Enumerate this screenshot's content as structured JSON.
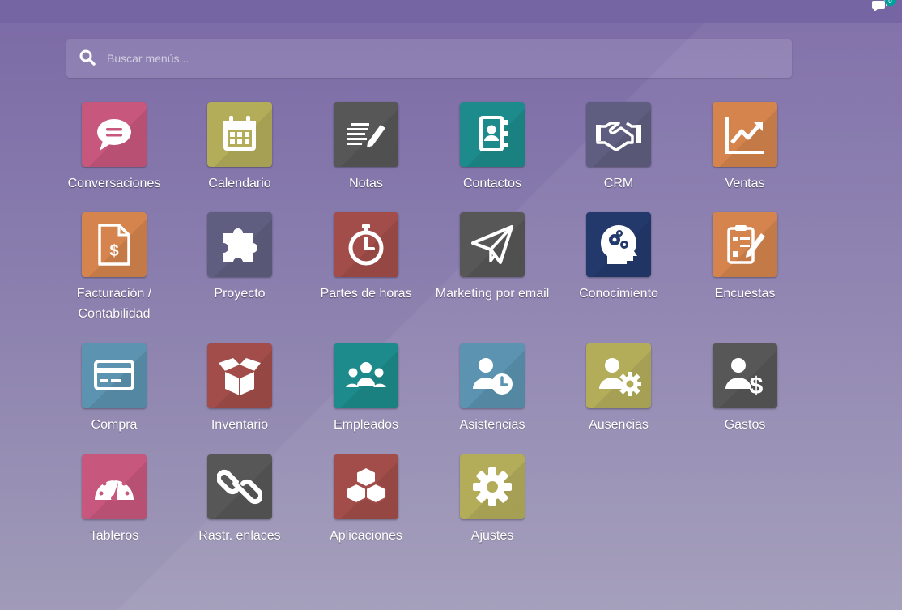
{
  "topbar": {
    "chat_badge": "0"
  },
  "search": {
    "placeholder": "Buscar menús..."
  },
  "apps": [
    {
      "label": "Conversaciones",
      "icon": "chat-bubble-icon",
      "color": "#c8577e"
    },
    {
      "label": "Calendario",
      "icon": "calendar-icon",
      "color": "#b3ad5a"
    },
    {
      "label": "Notas",
      "icon": "notes-pen-icon",
      "color": "#575757"
    },
    {
      "label": "Contactos",
      "icon": "address-book-icon",
      "color": "#1d8b8b"
    },
    {
      "label": "CRM",
      "icon": "handshake-icon",
      "color": "#5f5e80"
    },
    {
      "label": "Ventas",
      "icon": "line-chart-icon",
      "color": "#d5844d"
    },
    {
      "label": "Facturación /\nContabilidad",
      "icon": "invoice-dollar-icon",
      "color": "#d5844d"
    },
    {
      "label": "Proyecto",
      "icon": "puzzle-icon",
      "color": "#5f5e80"
    },
    {
      "label": "Partes de horas",
      "icon": "stopwatch-icon",
      "color": "#a24d4a"
    },
    {
      "label": "Marketing por email",
      "icon": "paper-plane-icon",
      "color": "#575757"
    },
    {
      "label": "Conocimiento",
      "icon": "head-gears-icon",
      "color": "#23396b"
    },
    {
      "label": "Encuestas",
      "icon": "clipboard-check-icon",
      "color": "#d5844d"
    },
    {
      "label": "Compra",
      "icon": "credit-card-icon",
      "color": "#5b93b0"
    },
    {
      "label": "Inventario",
      "icon": "open-box-icon",
      "color": "#a24d4a"
    },
    {
      "label": "Empleados",
      "icon": "people-group-icon",
      "color": "#1d8b8b"
    },
    {
      "label": "Asistencias",
      "icon": "user-clock-icon",
      "color": "#5b93b0"
    },
    {
      "label": "Ausencias",
      "icon": "user-gear-icon",
      "color": "#b3ad5a"
    },
    {
      "label": "Gastos",
      "icon": "user-dollar-icon",
      "color": "#575757"
    },
    {
      "label": "Tableros",
      "icon": "gauge-icon",
      "color": "#c8577e"
    },
    {
      "label": "Rastr. enlaces",
      "icon": "chain-link-icon",
      "color": "#575757"
    },
    {
      "label": "Aplicaciones",
      "icon": "cubes-icon",
      "color": "#a24d4a"
    },
    {
      "label": "Ajustes",
      "icon": "gear-icon",
      "color": "#b3ad5a"
    }
  ]
}
